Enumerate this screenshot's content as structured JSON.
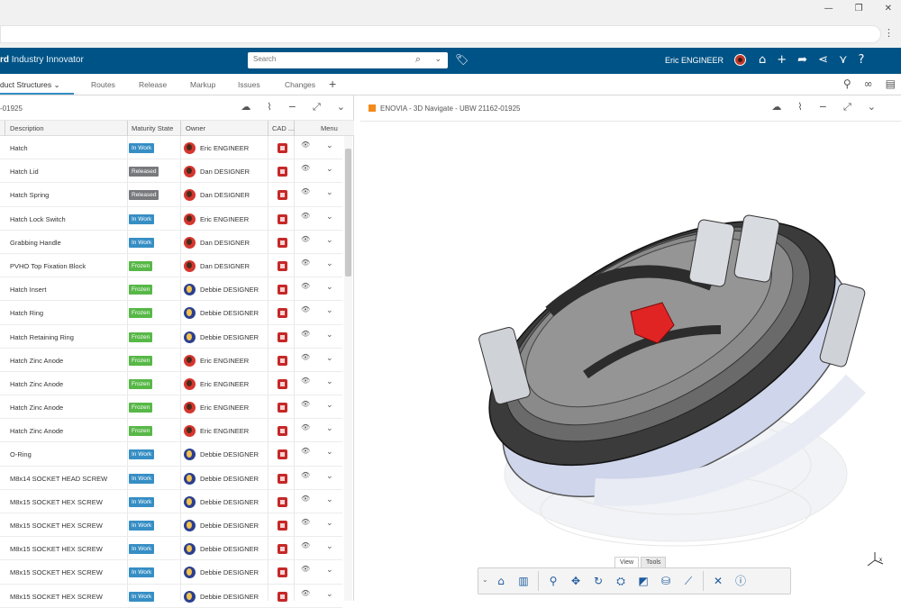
{
  "window": {
    "minimize": "—",
    "maximize": "❐",
    "close": "✕"
  },
  "header": {
    "brand_bold": "rd",
    "brand_rest": "Industry Innovator",
    "search_placeholder": "Search",
    "user_name": "Eric ENGINEER"
  },
  "tabs": [
    "duct Structures",
    "Routes",
    "Release",
    "Markup",
    "Issues",
    "Changes"
  ],
  "tab_add": "+",
  "left_panel": {
    "id": "-01925",
    "columns": [
      "Description",
      "Maturity State",
      "Owner",
      "CAD ...",
      "Menu"
    ],
    "rows": [
      {
        "desc": "Hatch",
        "state": "In Work",
        "owner": "Eric ENGINEER",
        "av": "red"
      },
      {
        "desc": "Hatch Lid",
        "state": "Released",
        "owner": "Dan DESIGNER",
        "av": "red"
      },
      {
        "desc": "Hatch Spring",
        "state": "Released",
        "owner": "Dan DESIGNER",
        "av": "red"
      },
      {
        "desc": "Hatch Lock Switch",
        "state": "In Work",
        "owner": "Eric ENGINEER",
        "av": "red"
      },
      {
        "desc": "Grabbing Handle",
        "state": "In Work",
        "owner": "Dan DESIGNER",
        "av": "red"
      },
      {
        "desc": "PVHO Top Fixation Block",
        "state": "Frozen",
        "owner": "Dan DESIGNER",
        "av": "red"
      },
      {
        "desc": "Hatch Insert",
        "state": "Frozen",
        "owner": "Debbie DESIGNER",
        "av": "blue"
      },
      {
        "desc": "Hatch Ring",
        "state": "Frozen",
        "owner": "Debbie DESIGNER",
        "av": "blue"
      },
      {
        "desc": "Hatch Retaining Ring",
        "state": "Frozen",
        "owner": "Debbie DESIGNER",
        "av": "blue"
      },
      {
        "desc": "Hatch Zinc Anode",
        "state": "Frozen",
        "owner": "Eric ENGINEER",
        "av": "red"
      },
      {
        "desc": "Hatch Zinc Anode",
        "state": "Frozen",
        "owner": "Eric ENGINEER",
        "av": "red"
      },
      {
        "desc": "Hatch Zinc Anode",
        "state": "Frozen",
        "owner": "Eric ENGINEER",
        "av": "red"
      },
      {
        "desc": "Hatch Zinc Anode",
        "state": "Frozen",
        "owner": "Eric ENGINEER",
        "av": "red"
      },
      {
        "desc": "O-Ring",
        "state": "In Work",
        "owner": "Debbie DESIGNER",
        "av": "blue"
      },
      {
        "desc": "M8x14 SOCKET HEAD SCREW",
        "state": "In Work",
        "owner": "Debbie DESIGNER",
        "av": "blue"
      },
      {
        "desc": "M8x15 SOCKET HEX SCREW",
        "state": "In Work",
        "owner": "Debbie DESIGNER",
        "av": "blue"
      },
      {
        "desc": "M8x15 SOCKET HEX SCREW",
        "state": "In Work",
        "owner": "Debbie DESIGNER",
        "av": "blue"
      },
      {
        "desc": "M8x15 SOCKET HEX SCREW",
        "state": "In Work",
        "owner": "Debbie DESIGNER",
        "av": "blue"
      },
      {
        "desc": "M8x15 SOCKET HEX SCREW",
        "state": "In Work",
        "owner": "Debbie DESIGNER",
        "av": "blue"
      },
      {
        "desc": "M8x15 SOCKET HEX SCREW",
        "state": "In Work",
        "owner": "Debbie DESIGNER",
        "av": "blue"
      }
    ],
    "scroll_position": 0.05
  },
  "viewer": {
    "title": "ENOVIA - 3D Navigate - UBW 21162-01925",
    "bottom_tabs": [
      "View",
      "Tools"
    ],
    "toolbar_icons": [
      "home-icon",
      "layout-icon",
      "zoom-icon",
      "pan-icon",
      "rotate-icon",
      "fit-icon",
      "section-icon",
      "cylinder-icon",
      "measure-icon",
      "close-icon",
      "info-icon"
    ],
    "axis_label": "x"
  },
  "colors": {
    "header_bg": "#005386",
    "accent": "#368ec4",
    "in_work": "#368ec4",
    "released": "#77797c",
    "frozen": "#57b847",
    "cad_red": "#c62828"
  }
}
